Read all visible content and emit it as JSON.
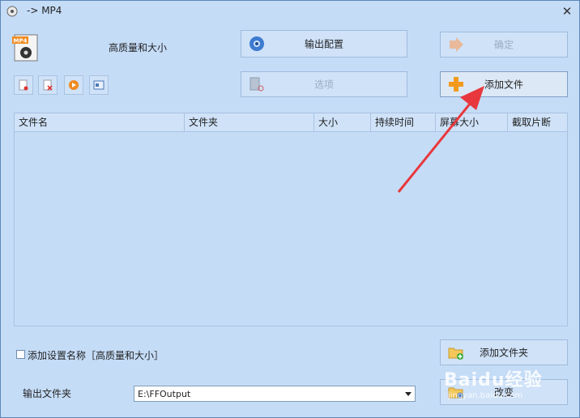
{
  "window": {
    "title": "-> MP4",
    "close_glyph": "✕"
  },
  "preset": {
    "name": "高质量和大小"
  },
  "buttons": {
    "output_config": "输出配置",
    "ok": "确定",
    "options": "选项",
    "add_file": "添加文件",
    "add_folder": "添加文件夹",
    "change": "改变"
  },
  "toolbar_icons": [
    "remove-file-icon",
    "clear-list-icon",
    "play-icon",
    "media-info-icon"
  ],
  "table": {
    "columns": [
      "文件名",
      "文件夹",
      "大小",
      "持续时间",
      "屏幕大小",
      "截取片断"
    ],
    "rows": []
  },
  "options": {
    "add_setting_name_label": "添加设置名称［高质量和大小］",
    "add_setting_name_checked": false
  },
  "output": {
    "label": "输出文件夹",
    "path": "E:\\FFOutput"
  },
  "watermark": {
    "brand": "Baidu经验",
    "url": "jingyan.baidu.com"
  },
  "colors": {
    "window_bg": "#c5dcf7",
    "accent_arrow": "#e8383d",
    "add_icon": "#f29a1d"
  }
}
